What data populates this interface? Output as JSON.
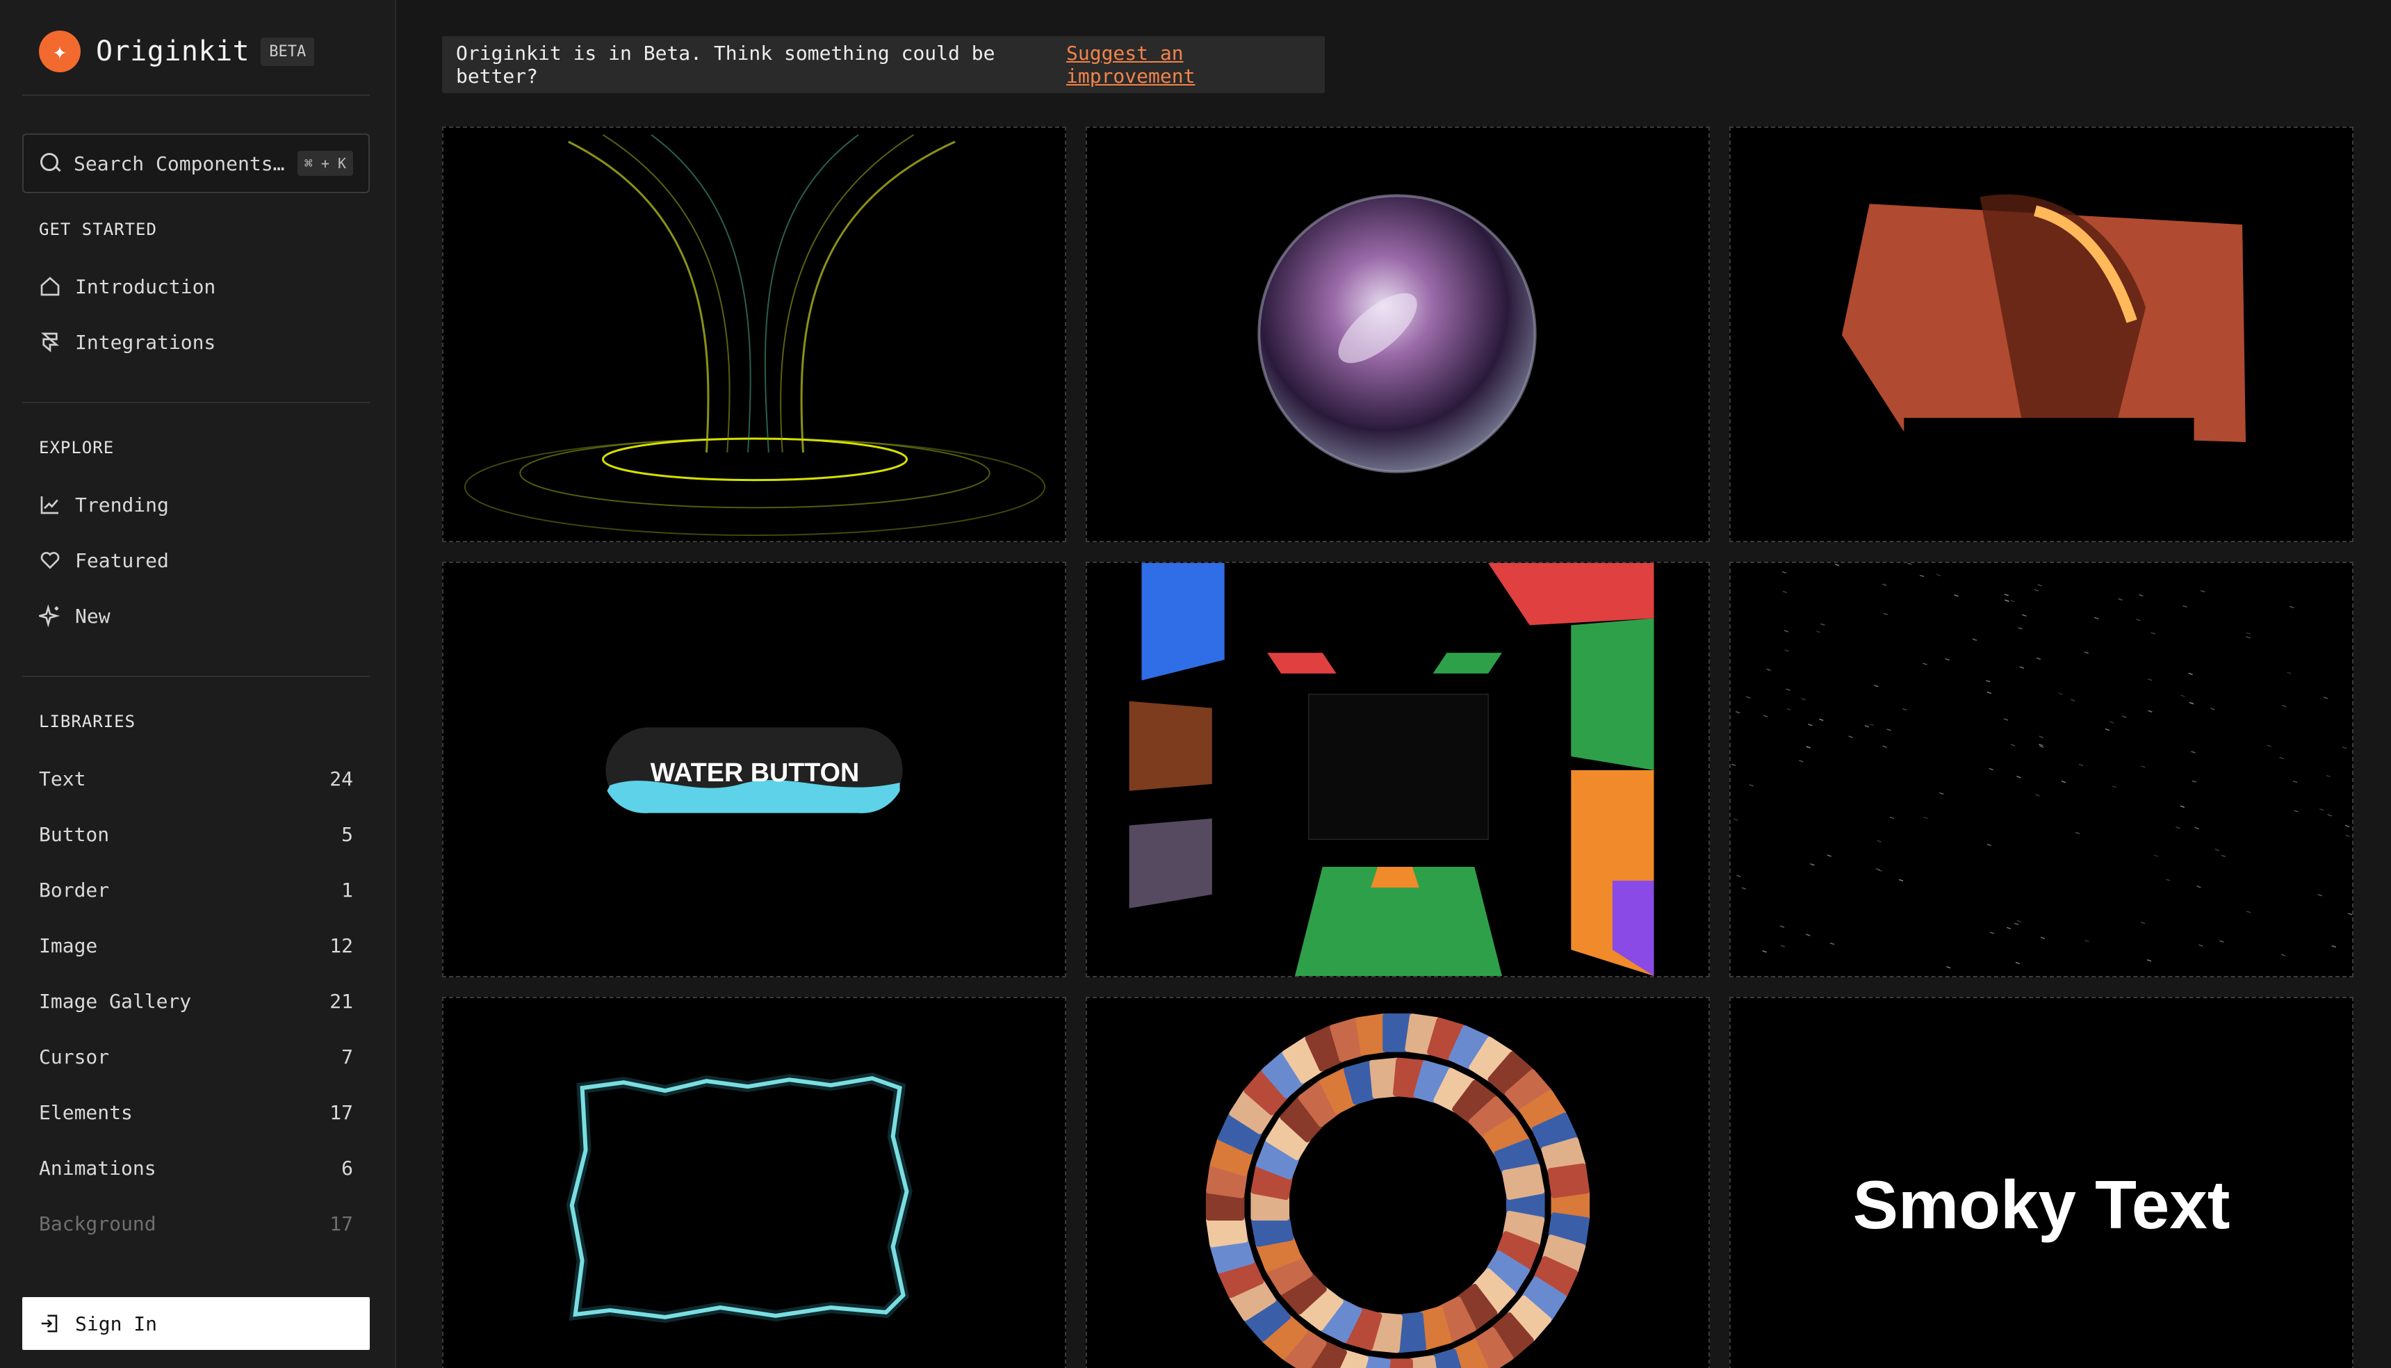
{
  "brand": {
    "name": "Originkit",
    "badge": "BETA"
  },
  "search": {
    "placeholder": "Search Components…",
    "shortcut": "⌘ + K"
  },
  "sections": {
    "get_started": "GET STARTED",
    "explore": "EXPLORE",
    "libraries": "LIBRARIES"
  },
  "get_started": [
    {
      "label": "Introduction",
      "icon": "home-icon"
    },
    {
      "label": "Integrations",
      "icon": "framer-icon"
    }
  ],
  "explore": [
    {
      "label": "Trending",
      "icon": "trending-chart-icon"
    },
    {
      "label": "Featured",
      "icon": "heart-icon"
    },
    {
      "label": "New",
      "icon": "sparkles-icon"
    }
  ],
  "libraries": [
    {
      "label": "Text",
      "count": "24"
    },
    {
      "label": "Button",
      "count": "5"
    },
    {
      "label": "Border",
      "count": "1"
    },
    {
      "label": "Image",
      "count": "12"
    },
    {
      "label": "Image Gallery",
      "count": "21"
    },
    {
      "label": "Cursor",
      "count": "7"
    },
    {
      "label": "Elements",
      "count": "17"
    },
    {
      "label": "Animations",
      "count": "6"
    },
    {
      "label": "Background",
      "count": "17"
    }
  ],
  "signin": {
    "label": "Sign In"
  },
  "banner": {
    "text": "Originkit is in Beta. Think something could be better?",
    "link": "Suggest an improvement"
  },
  "cards": {
    "water_button": "WATER BUTTON",
    "smoky_text": "Smoky Text"
  },
  "colors": {
    "accent": "#f26a2e",
    "link": "#f2844a",
    "bg": "#171717",
    "sidebar": "#1c1c1c"
  }
}
